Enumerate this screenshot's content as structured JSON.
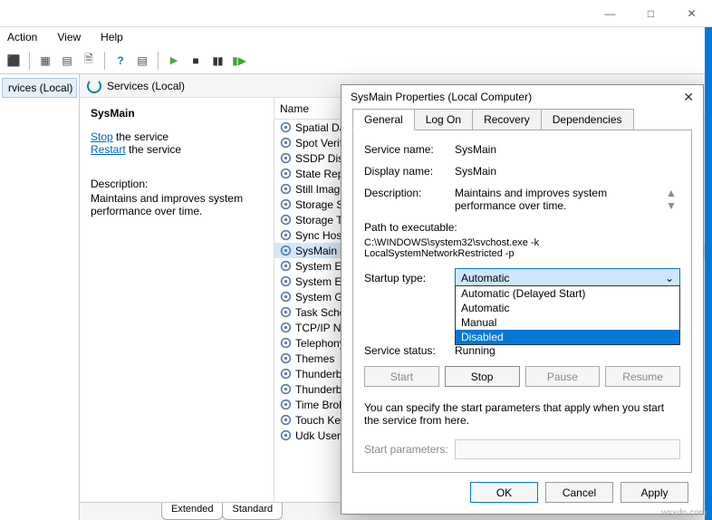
{
  "titlebar": {
    "minimize": "—",
    "maximize": "□",
    "close": "✕"
  },
  "menu": {
    "action": "Action",
    "view": "View",
    "help": "Help"
  },
  "left_pane": {
    "item": "rvices (Local)"
  },
  "header": {
    "title": "Services (Local)"
  },
  "detail": {
    "name": "SysMain",
    "stop_link": "Stop",
    "stop_suffix": " the service",
    "restart_link": "Restart",
    "restart_suffix": " the service",
    "desc_label": "Description:",
    "desc_text": "Maintains and improves system performance over time."
  },
  "list": {
    "header": "Name",
    "items": [
      "Spatial Dat",
      "Spot Verific",
      "SSDP Disco",
      "State Repo",
      "Still Image",
      "Storage Se",
      "Storage Tie",
      "Sync Host_",
      "SysMain",
      "System Eve",
      "System Eve",
      "System Gu",
      "Task Sched",
      "TCP/IP Net",
      "Telephony",
      "Themes",
      "Thunderbo",
      "Thunderbo",
      "Time Broke",
      "Touch Keyb",
      "Udk User S"
    ],
    "selected_index": 8
  },
  "tabs": {
    "extended": "Extended",
    "standard": "Standard"
  },
  "dialog": {
    "title": "SysMain Properties (Local Computer)",
    "tabs": [
      "General",
      "Log On",
      "Recovery",
      "Dependencies"
    ],
    "service_name_label": "Service name:",
    "service_name": "SysMain",
    "display_name_label": "Display name:",
    "display_name": "SysMain",
    "description_label": "Description:",
    "description": "Maintains and improves system performance over time.",
    "path_label": "Path to executable:",
    "path": "C:\\WINDOWS\\system32\\svchost.exe -k LocalSystemNetworkRestricted -p",
    "startup_label": "Startup type:",
    "startup_value": "Automatic",
    "startup_options": [
      "Automatic (Delayed Start)",
      "Automatic",
      "Manual",
      "Disabled"
    ],
    "startup_hover_index": 3,
    "status_label": "Service status:",
    "status_value": "Running",
    "btn_start": "Start",
    "btn_stop": "Stop",
    "btn_pause": "Pause",
    "btn_resume": "Resume",
    "help_text": "You can specify the start parameters that apply when you start the service from here.",
    "param_label": "Start parameters:",
    "btn_ok": "OK",
    "btn_cancel": "Cancel",
    "btn_apply": "Apply"
  },
  "watermark": "wsxdn.com"
}
